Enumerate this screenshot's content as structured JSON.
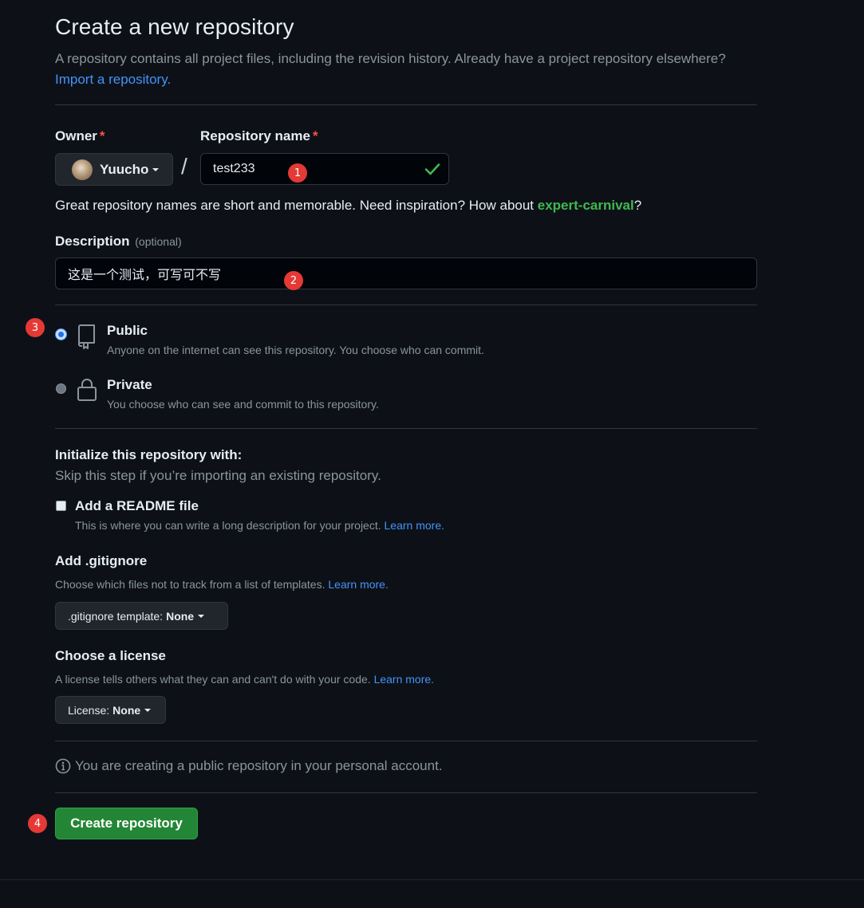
{
  "header": {
    "title": "Create a new repository",
    "subtitle": "A repository contains all project files, including the revision history. Already have a project repository elsewhere?",
    "import_link": "Import a repository."
  },
  "owner": {
    "label": "Owner",
    "required_mark": "*",
    "value": "Yuucho"
  },
  "repo_name": {
    "label": "Repository name",
    "required_mark": "*",
    "value": "test233",
    "valid": true
  },
  "separator": "/",
  "name_hint": {
    "text": "Great repository names are short and memorable. Need inspiration? How about ",
    "suggestion": "expert-carnival",
    "suffix": "?"
  },
  "description": {
    "label": "Description",
    "optional": "(optional)",
    "value": "这是一个测试，可写可不写"
  },
  "visibility": {
    "selected": "public",
    "options": [
      {
        "title": "Public",
        "desc": "Anyone on the internet can see this repository. You choose who can commit.",
        "icon": "repo-icon"
      },
      {
        "title": "Private",
        "desc": "You choose who can see and commit to this repository.",
        "icon": "lock-icon"
      }
    ]
  },
  "init": {
    "heading": "Initialize this repository with:",
    "sub": "Skip this step if you’re importing an existing repository.",
    "readme": {
      "label": "Add a README file",
      "desc": "This is where you can write a long description for your project.",
      "learn": "Learn more.",
      "checked": false
    }
  },
  "gitignore": {
    "heading": "Add .gitignore",
    "desc": "Choose which files not to track from a list of templates.",
    "learn": "Learn more.",
    "select_prefix": ".gitignore template:",
    "select_value": "None"
  },
  "license": {
    "heading": "Choose a license",
    "desc": "A license tells others what they can and can't do with your code.",
    "learn": "Learn more.",
    "select_prefix": "License:",
    "select_value": "None"
  },
  "notice": "You are creating a public repository in your personal account.",
  "create_button": "Create repository",
  "markers": [
    "1",
    "2",
    "3",
    "4"
  ],
  "colors": {
    "background": "#0d1117",
    "primary_button": "#238636",
    "link": "#4493f8",
    "marker": "#e53935",
    "success": "#3fb950"
  }
}
